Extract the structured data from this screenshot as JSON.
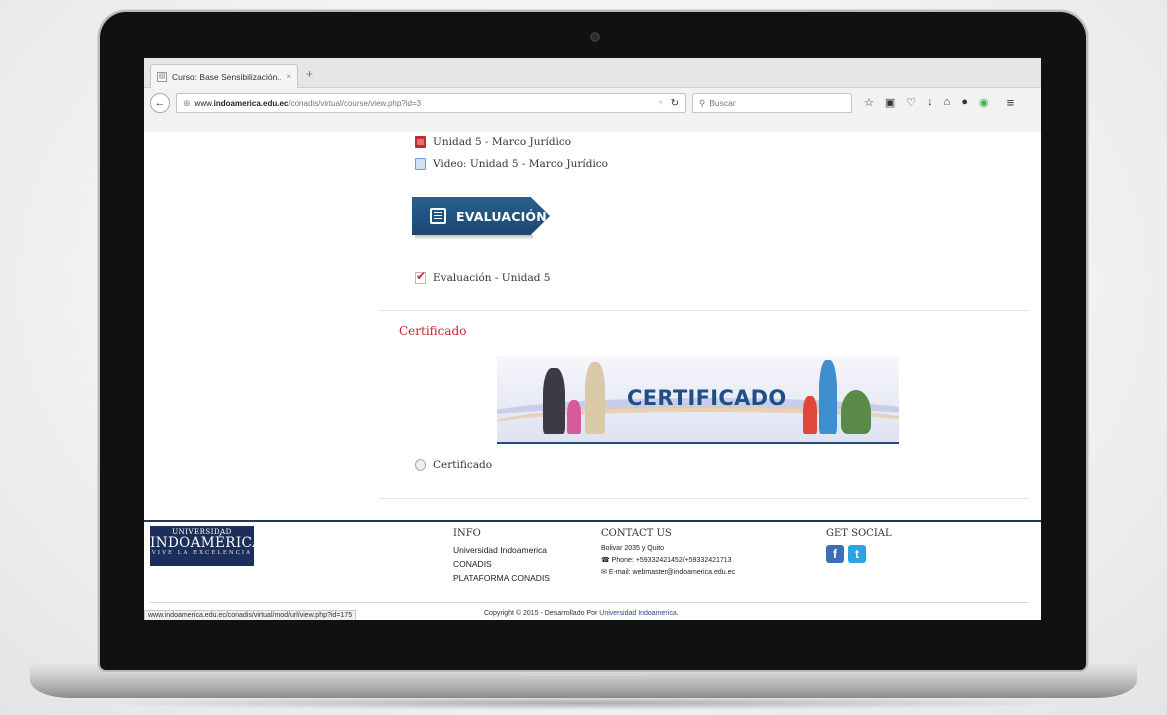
{
  "browser": {
    "tab_title": "Curso: Base Sensibilización...",
    "tab_close": "×",
    "new_tab": "+",
    "url_prefix": "www.",
    "url_domain": "indoamerica.edu.ec",
    "url_path": "/conadis/virtual/course/view.php?id=3",
    "search_placeholder": "Buscar",
    "status_url": "www.indoamerica.edu.ec/conadis/virtual/mod/url/view.php?id=175"
  },
  "course": {
    "activities_top": [
      {
        "label": "Unidad 5 - Marco Jurídico",
        "icon": "pdf-icon"
      },
      {
        "label": "Video: Unidad 5 - Marco Jurídico",
        "icon": "file-icon"
      }
    ],
    "evaluation_banner": "EVALUACIÓN",
    "evaluation_activity": "Evaluación - Unidad 5",
    "certificate_section_title": "Certificado",
    "certificate_banner": "CERTIFICADO",
    "certificate_activity": "Certificado"
  },
  "footer": {
    "logo": {
      "top": "UNIVERSIDAD",
      "main": "INDOAMÉRICA",
      "sub": "VIVE LA EXCELENCIA"
    },
    "info": {
      "heading": "INFO",
      "links": [
        "Universidad Indoamerica",
        "CONADIS",
        "PLATAFORMA CONADIS"
      ]
    },
    "contact": {
      "heading": "CONTACT US",
      "address": "Bolivar 2035 y Quito",
      "phone": "Phone: +59332421452/+59332421713",
      "email": "E-mail: webmaster@indoamerica.edu.ec"
    },
    "social": {
      "heading": "GET SOCIAL",
      "facebook": "f",
      "twitter": "t"
    },
    "copyright_prefix": "Copyright © 2015 - Desarrollado Por",
    "copyright_org": "Universidad Indoamerica."
  },
  "colors": {
    "accent_red": "#c8272d",
    "navy": "#1c2f5b",
    "banner_blue": "#1f4f86"
  }
}
